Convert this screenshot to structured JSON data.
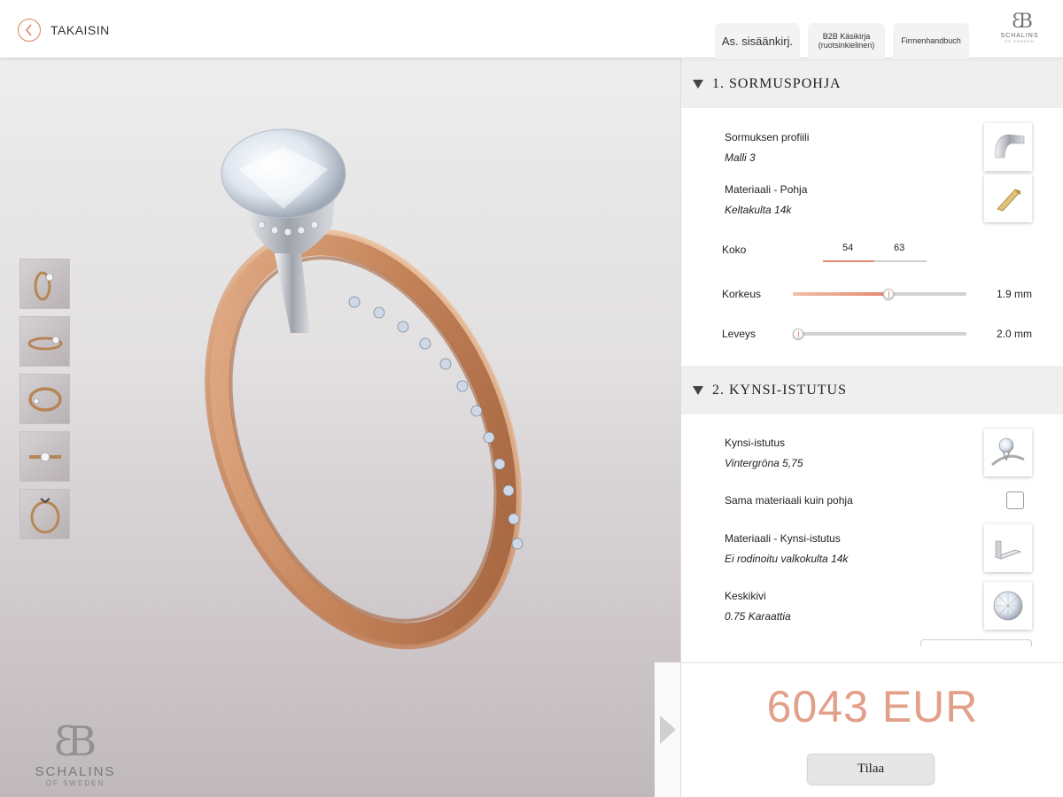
{
  "header": {
    "back_label": "TAKAISIN",
    "tabs": [
      {
        "label": "As. sisäänkirj."
      },
      {
        "label_line1": "B2B Käsikirja",
        "label_line2": "(ruotsinkielinen)"
      },
      {
        "label": "Firmenhandbuch"
      }
    ],
    "brand": {
      "monogram": "ƐB",
      "name": "SCHALINS",
      "sub": "OF SWEDEN"
    }
  },
  "viewer": {
    "thumbnails": [
      {
        "icon": "ring-front-view-icon"
      },
      {
        "icon": "ring-side-view-icon"
      },
      {
        "icon": "ring-angle-view-icon"
      },
      {
        "icon": "ring-top-view-icon"
      },
      {
        "icon": "ring-profile-view-icon"
      }
    ],
    "watermark": {
      "monogram": "ƐB",
      "name": "SCHALINS",
      "sub": "OF SWEDEN"
    }
  },
  "sections": [
    {
      "title": "1. SORMUSPOHJA",
      "options": [
        {
          "label": "Sormuksen profiili",
          "value": "Malli 3",
          "icon": "ring-profile-swatch-icon"
        },
        {
          "label": "Materiaali - Pohja",
          "value": "Keltakulta 14k",
          "icon": "yellow-gold-bar-icon"
        }
      ],
      "size": {
        "label": "Koko",
        "options": [
          "54",
          "63"
        ],
        "selected": "54"
      },
      "sliders": [
        {
          "label": "Korkeus",
          "value_text": "1.9 mm",
          "level": 0.55
        },
        {
          "label": "Leveys",
          "value_text": "2.0 mm",
          "level": 0.0
        }
      ]
    },
    {
      "title": "2. KYNSI-ISTUTUS",
      "options": [
        {
          "label": "Kynsi-istutus",
          "value": "Vintergröna 5,75",
          "icon": "prong-setting-swatch-icon"
        },
        {
          "label": "Materiaali - Kynsi-istutus",
          "value": "Ei rodinoitu valkokulta 14k",
          "icon": "white-gold-bar-icon"
        },
        {
          "label": "Keskikivi",
          "value": "0.75 Karaattia",
          "icon": "diamond-icon"
        }
      ],
      "checkbox": {
        "label": "Sama materiaali kuin pohja",
        "checked": false
      }
    }
  ],
  "price": {
    "text": "6043 EUR",
    "order_label": "Tilaa"
  },
  "colors": {
    "accent": "#e28a76",
    "price": "#e2a08a",
    "rose_gold": "#c98a5c"
  }
}
